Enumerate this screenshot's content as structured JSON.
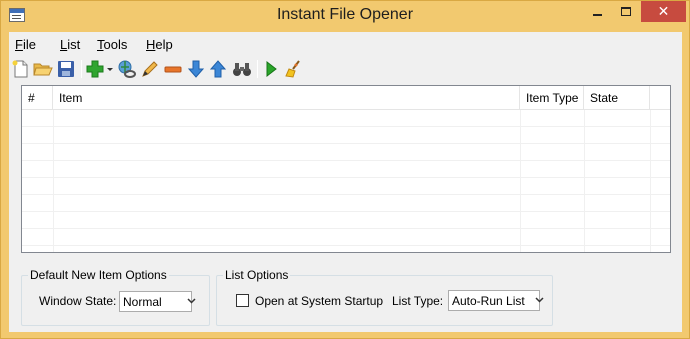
{
  "window": {
    "title": "Instant File Opener",
    "close_glyph": "✕"
  },
  "menu": {
    "items": [
      {
        "label": "File",
        "mnemonic": "F"
      },
      {
        "label": "List",
        "mnemonic": "L"
      },
      {
        "label": "Tools",
        "mnemonic": "T"
      },
      {
        "label": "Help",
        "mnemonic": "H"
      }
    ]
  },
  "toolbar": {
    "buttons": [
      {
        "icon": "new-file-icon"
      },
      {
        "icon": "open-folder-icon"
      },
      {
        "icon": "save-icon"
      },
      {
        "icon": "add-item-icon"
      },
      {
        "icon": "add-dropdown-arrow-icon"
      },
      {
        "icon": "link-icon"
      },
      {
        "icon": "edit-pencil-icon"
      },
      {
        "icon": "remove-icon"
      },
      {
        "icon": "move-down-icon"
      },
      {
        "icon": "move-up-icon"
      },
      {
        "icon": "find-binoculars-icon"
      },
      {
        "icon": "run-icon"
      },
      {
        "icon": "clear-broom-icon"
      }
    ]
  },
  "list": {
    "columns": [
      "#",
      "Item",
      "Item Type",
      "State"
    ],
    "rows": []
  },
  "default_new_item_options": {
    "title": "Default New Item Options",
    "window_state_label": "Window State:",
    "window_state_value": "Normal"
  },
  "list_options": {
    "title": "List Options",
    "startup_label": "Open at System Startup",
    "startup_checked": false,
    "list_type_label": "List Type:",
    "list_type_value": "Auto-Run List"
  },
  "colors": {
    "titlebar": "#f2c96f",
    "close_button": "#c74b3f",
    "client_bg": "#f0f0f0"
  }
}
